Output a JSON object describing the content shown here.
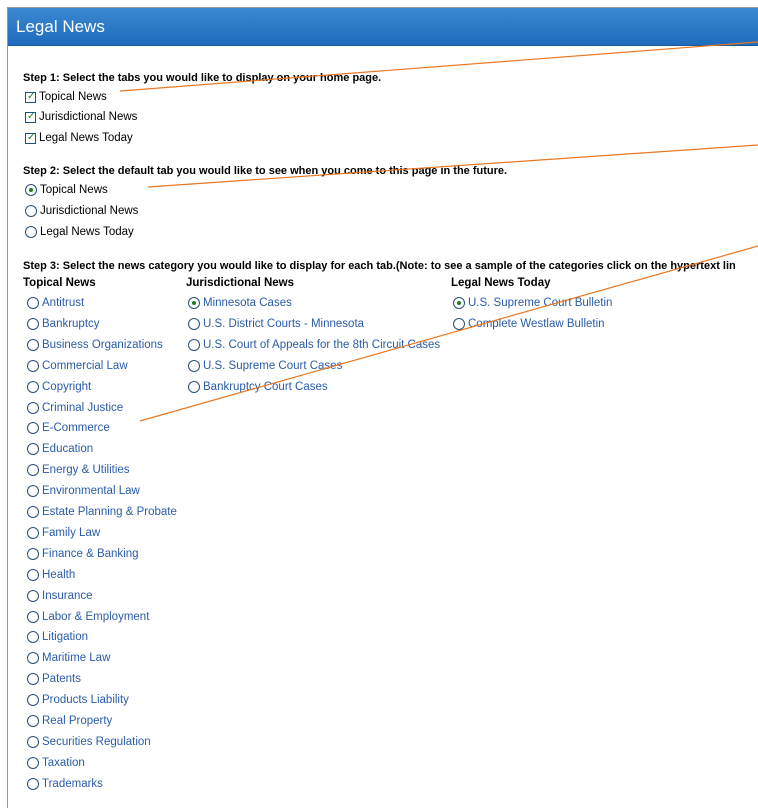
{
  "header": {
    "title": "Legal News"
  },
  "step1": {
    "label": "Step 1: Select the tabs you would like to display on your home page.",
    "items": [
      {
        "label": "Topical News",
        "checked": true
      },
      {
        "label": "Jurisdictional News",
        "checked": true
      },
      {
        "label": "Legal News Today",
        "checked": true
      }
    ]
  },
  "step2": {
    "label": "Step 2: Select the default tab you would like to see when you come to this page in the future.",
    "items": [
      {
        "label": "Topical News",
        "selected": true
      },
      {
        "label": "Jurisdictional News",
        "selected": false
      },
      {
        "label": "Legal News Today",
        "selected": false
      }
    ]
  },
  "step3": {
    "label": "Step 3: Select the news category you would like to display for each tab.(Note: to see a sample of the categories click on the hypertext lin",
    "columns": [
      {
        "heading": "Topical News",
        "items": [
          {
            "label": "Antitrust",
            "selected": false
          },
          {
            "label": "Bankruptcy",
            "selected": false
          },
          {
            "label": "Business Organizations",
            "selected": false
          },
          {
            "label": "Commercial Law",
            "selected": false
          },
          {
            "label": "Copyright",
            "selected": false
          },
          {
            "label": "Criminal Justice",
            "selected": false
          },
          {
            "label": "E-Commerce",
            "selected": false
          },
          {
            "label": "Education",
            "selected": false
          },
          {
            "label": "Energy & Utilities",
            "selected": false
          },
          {
            "label": "Environmental Law",
            "selected": false
          },
          {
            "label": "Estate Planning & Probate",
            "selected": false
          },
          {
            "label": "Family Law",
            "selected": false
          },
          {
            "label": "Finance & Banking",
            "selected": false
          },
          {
            "label": "Health",
            "selected": false
          },
          {
            "label": "Insurance",
            "selected": false
          },
          {
            "label": "Labor & Employment",
            "selected": false
          },
          {
            "label": "Litigation",
            "selected": false
          },
          {
            "label": "Maritime Law",
            "selected": false
          },
          {
            "label": "Patents",
            "selected": false
          },
          {
            "label": "Products Liability",
            "selected": false
          },
          {
            "label": "Real Property",
            "selected": false
          },
          {
            "label": "Securities Regulation",
            "selected": false
          },
          {
            "label": "Taxation",
            "selected": false
          },
          {
            "label": "Trademarks",
            "selected": false
          }
        ]
      },
      {
        "heading": "Jurisdictional News",
        "items": [
          {
            "label": "Minnesota Cases",
            "selected": true
          },
          {
            "label": "U.S. District Courts - Minnesota",
            "selected": false
          },
          {
            "label": "U.S. Court of Appeals for the 8th Circuit Cases",
            "selected": false
          },
          {
            "label": "U.S. Supreme Court Cases",
            "selected": false
          },
          {
            "label": "Bankruptcy Court Cases",
            "selected": false
          }
        ]
      },
      {
        "heading": "Legal News Today",
        "items": [
          {
            "label": "U.S. Supreme Court Bulletin",
            "selected": true
          },
          {
            "label": "Complete Westlaw Bulletin",
            "selected": false
          }
        ]
      }
    ]
  },
  "colors": {
    "header_bg": "#2a7ac8",
    "link": "#2a5ca8",
    "callout_line": "#e87722",
    "check_mark": "#1a8a1a"
  }
}
